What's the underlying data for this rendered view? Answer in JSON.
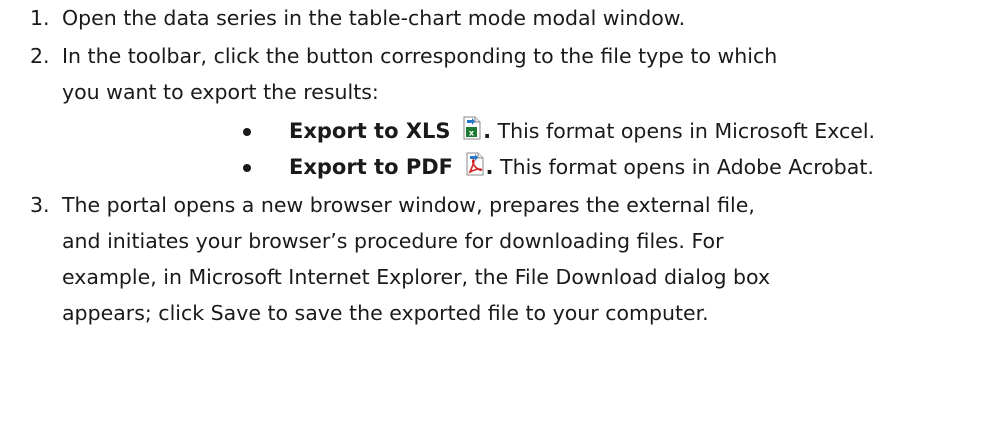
{
  "steps": [
    {
      "number": "1.",
      "lines": [
        "Open the data series in the table-chart mode modal window."
      ]
    },
    {
      "number": "2.",
      "lines": [
        "In the toolbar, click the button corresponding to the file type to which",
        "you want to export the results:"
      ]
    },
    {
      "number": "3.",
      "lines": [
        "The portal opens a new browser window, prepares the external file,",
        "and initiates your browser’s procedure for downloading files. For",
        "example, in Microsoft Internet Explorer, the File Download dialog box",
        "appears; click Save to save the exported file to your computer."
      ]
    }
  ],
  "bullets": [
    {
      "label": "Export to XLS",
      "icon": "excel-export-icon",
      "after_icon": ".",
      "description": " This format opens in Microsoft Excel."
    },
    {
      "label": "Export to PDF",
      "icon": "pdf-export-icon",
      "after_icon": ".",
      "description": " This format opens in Adobe Acrobat."
    }
  ],
  "colors": {
    "text": "#1a1a1a",
    "excel_green": "#1e7b34",
    "pdf_red": "#d21f1f",
    "arrow_blue": "#2a78c8"
  }
}
